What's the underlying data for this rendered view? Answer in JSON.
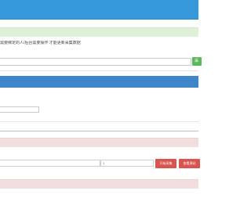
{
  "header": {
    "tip_text": "需要绑定的人/后台需要操作 才能更新采集数据"
  },
  "actions": {
    "go_label": "采",
    "start_label": "开始采集",
    "view_label": "查看源站"
  },
  "fields": {
    "mid_value": "1"
  },
  "colors": {
    "topbar": "#3498db",
    "notice_green": "#dff0d8",
    "band_blue": "#3d87c9",
    "alert_pink": "#f2dede",
    "button_green": "#5cb85c",
    "button_red": "#d9534f"
  }
}
